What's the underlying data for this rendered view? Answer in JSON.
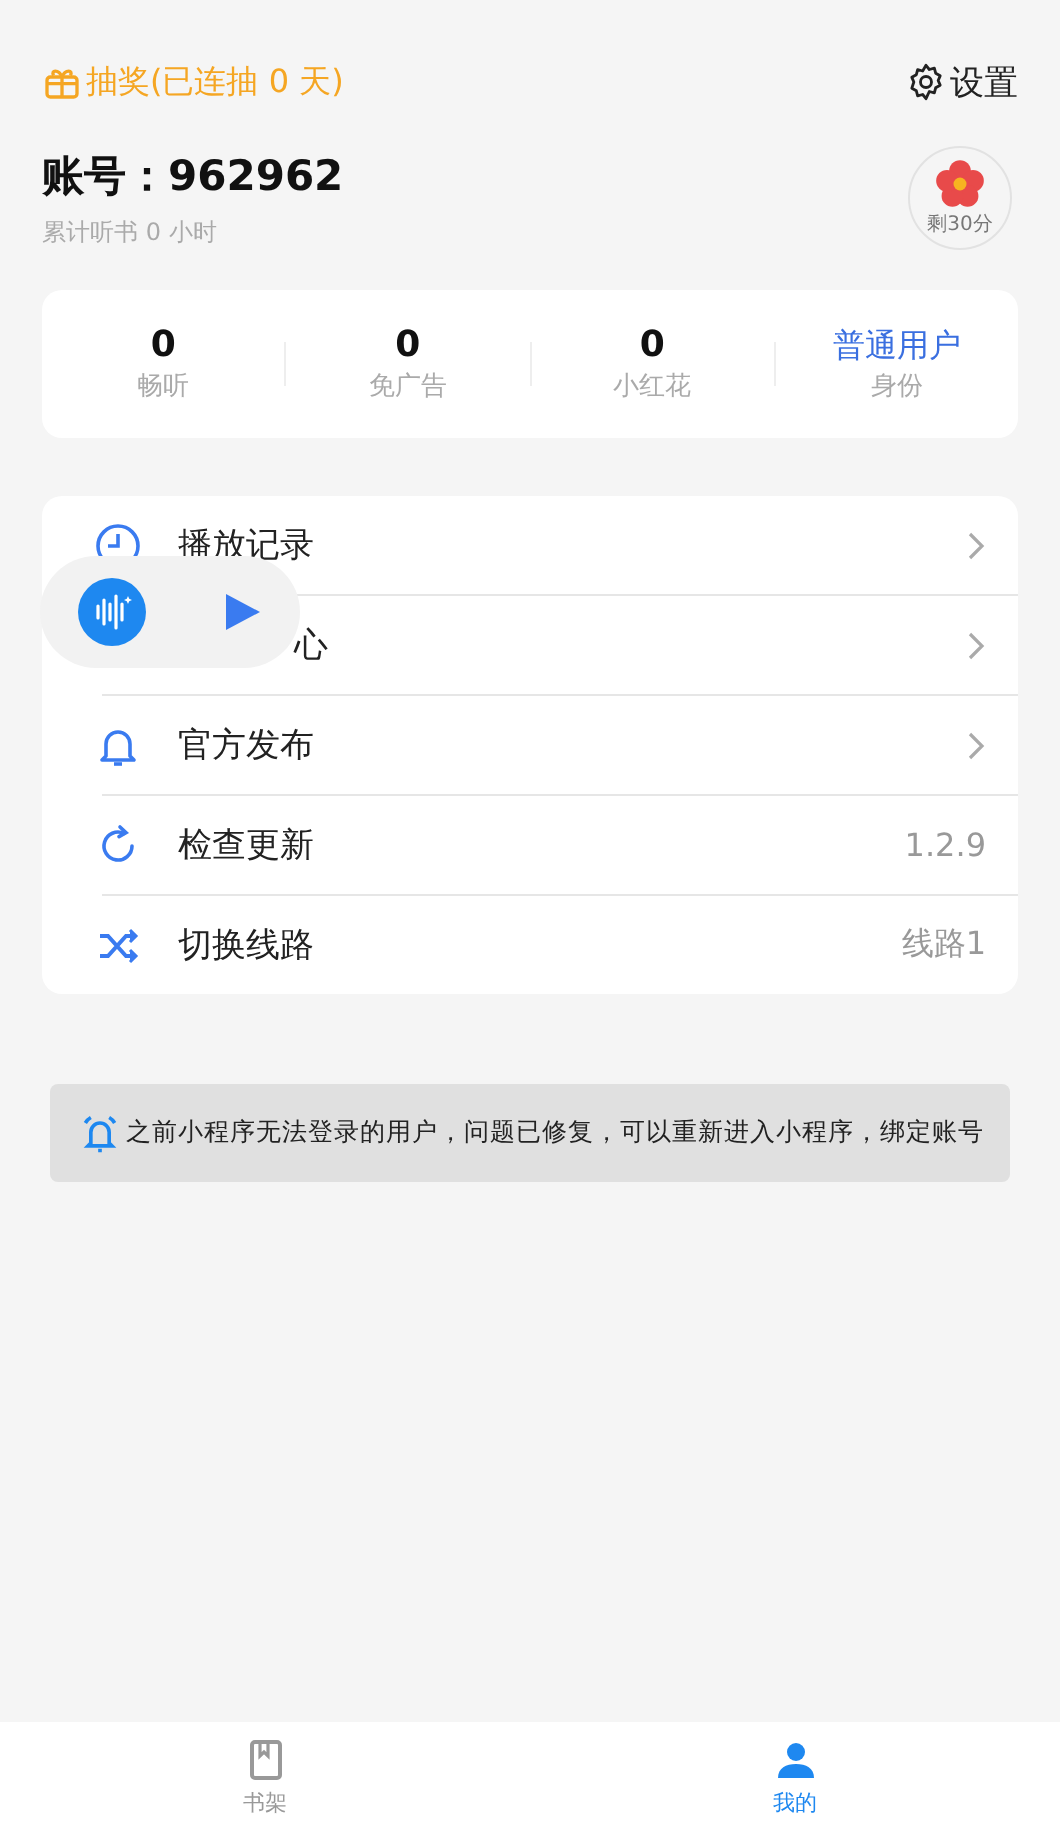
{
  "header": {
    "lottery": "抽奖(已连抽 0 天)",
    "settings": "设置"
  },
  "account": {
    "title": "账号：962962",
    "listen_time": "累计听书 0 小时",
    "timer": "剩30分"
  },
  "stats": [
    {
      "value": "0",
      "label": "畅听",
      "kind": "number"
    },
    {
      "value": "0",
      "label": "免广告",
      "kind": "number"
    },
    {
      "value": "0",
      "label": "小红花",
      "kind": "number"
    },
    {
      "value": "普通用户",
      "label": "身份",
      "kind": "text"
    }
  ],
  "menu": [
    {
      "label": "播放记录",
      "kind": "clock",
      "trailing": {
        "kind": "chevron"
      }
    },
    {
      "label": "心",
      "trailing": {
        "kind": "chevron"
      }
    },
    {
      "label": "官方发布",
      "kind": "bell",
      "trailing": {
        "kind": "chevron"
      }
    },
    {
      "label": "检查更新",
      "kind": "refresh",
      "trailing": {
        "kind": "text",
        "text": "1.2.9"
      }
    },
    {
      "label": "切换线路",
      "kind": "shuffle",
      "trailing": {
        "kind": "text",
        "text": "线路1"
      }
    }
  ],
  "player": {
    "playing": false
  },
  "notice": {
    "text": "之前小程序无法登录的用户，问题已修复，可以重新进入小程序，绑定账号"
  },
  "tabs": [
    {
      "label": "书架",
      "kind": "book",
      "selected": false
    },
    {
      "label": "我的",
      "kind": "person",
      "selected": true
    }
  ]
}
